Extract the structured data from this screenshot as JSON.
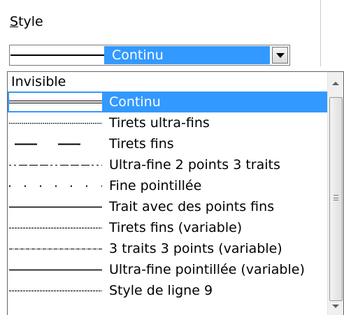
{
  "style_section": {
    "label_access_key": "S",
    "label_rest": "tyle"
  },
  "combo": {
    "selected_value": "Continu",
    "selected_style": "continuous"
  },
  "list": {
    "items": [
      {
        "label": "Invisible",
        "style": "none",
        "selected": false
      },
      {
        "label": "Continu",
        "style": "continuous",
        "selected": true
      },
      {
        "label": "Tirets ultra-fins",
        "style": "ultrafine-dashed",
        "selected": false
      },
      {
        "label": "Tirets fins",
        "style": "fine-dashed",
        "selected": false
      },
      {
        "label": "Ultra-fine 2 points 3 traits",
        "style": "2dots-3dashes",
        "selected": false
      },
      {
        "label": "Fine pointillée",
        "style": "fine-dotted",
        "selected": false
      },
      {
        "label": "Trait avec des points fins",
        "style": "line-fine-dots",
        "selected": false
      },
      {
        "label": "Tirets fins (variable)",
        "style": "fine-dashed-variable",
        "selected": false
      },
      {
        "label": "3 traits 3 points (variable)",
        "style": "3dashes-3dots-variable",
        "selected": false
      },
      {
        "label": "Ultra-fine pointillée (variable)",
        "style": "ultrafine-dotted-variable",
        "selected": false
      },
      {
        "label": "Style de ligne 9",
        "style": "line-style-9",
        "selected": false
      }
    ]
  },
  "icons": {
    "dropdown_button": "chevron-down-icon",
    "scroll_up": "scroll-up-arrow-icon",
    "scroll_down": "scroll-down-arrow-icon",
    "scroll_grip": "grip-icon"
  },
  "colors": {
    "selection": "#3399ff",
    "selection_text": "#ffffff"
  }
}
